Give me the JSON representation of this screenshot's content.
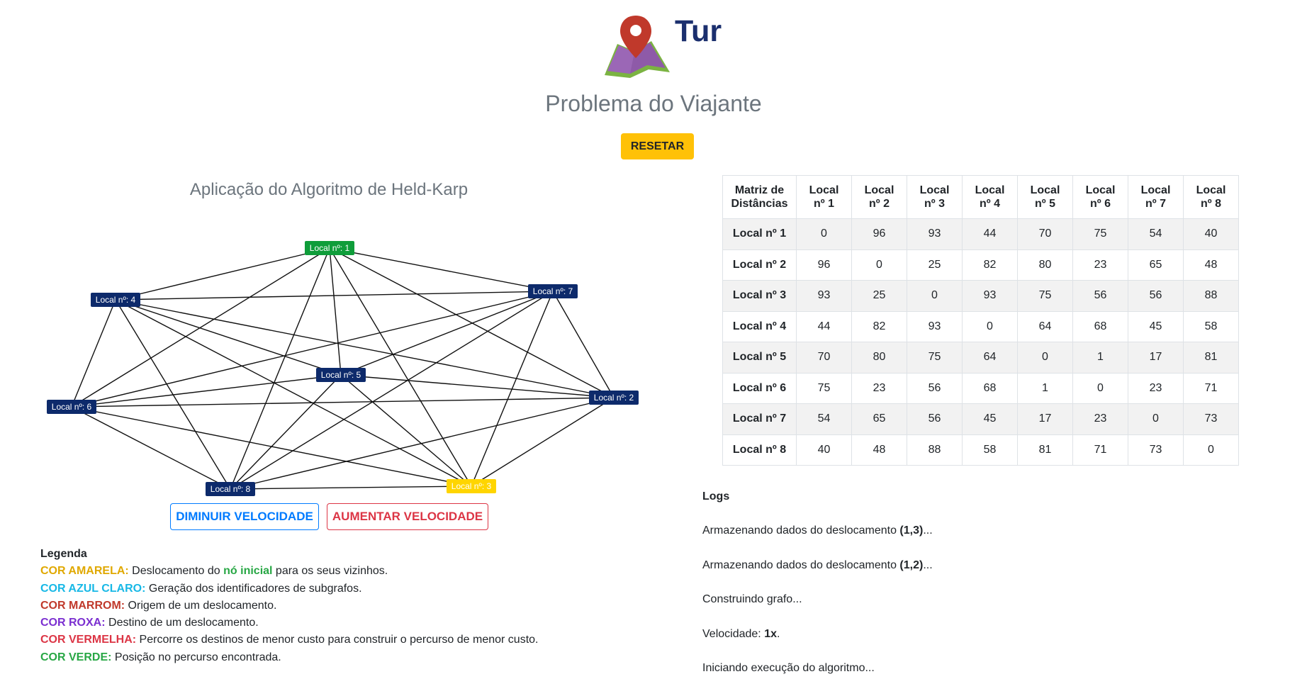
{
  "header": {
    "brand": "Tur",
    "subtitle": "Problema do Viajante",
    "reset_label": "RESETAR",
    "logo_icon": "map-pin-icon"
  },
  "graph": {
    "title": "Aplicação do Algoritmo de Held-Karp",
    "nodes": [
      {
        "id": 1,
        "label": "Local nº: 1",
        "color": "#0f9d3a",
        "text_color": "#ffffff"
      },
      {
        "id": 2,
        "label": "Local nº: 2",
        "color": "#0d2a6b",
        "text_color": "#ffffff"
      },
      {
        "id": 3,
        "label": "Local nº: 3",
        "color": "#ffd500",
        "text_color": "#ffffff"
      },
      {
        "id": 4,
        "label": "Local nº: 4",
        "color": "#0d2a6b",
        "text_color": "#ffffff"
      },
      {
        "id": 5,
        "label": "Local nº: 5",
        "color": "#0d2a6b",
        "text_color": "#ffffff"
      },
      {
        "id": 6,
        "label": "Local nº: 6",
        "color": "#0d2a6b",
        "text_color": "#ffffff"
      },
      {
        "id": 7,
        "label": "Local nº: 7",
        "color": "#0d2a6b",
        "text_color": "#ffffff"
      },
      {
        "id": 8,
        "label": "Local nº: 8",
        "color": "#0d2a6b",
        "text_color": "#ffffff"
      }
    ]
  },
  "controls": {
    "slower_label": "DIMINUIR VELOCIDADE",
    "faster_label": "AUMENTAR VELOCIDADE"
  },
  "legend": {
    "title": "Legenda",
    "items": [
      {
        "key": "COR AMARELA:",
        "key_color": "#e0a800",
        "pre": " Deslocamento do ",
        "highlight": "nó inicial",
        "highlight_color": "#28a745",
        "post": " para os seus vizinhos."
      },
      {
        "key": "COR AZUL CLARO:",
        "key_color": "#17b8e6",
        "text": " Geração dos identificadores de subgrafos."
      },
      {
        "key": "COR MARROM:",
        "key_color": "#c0392b",
        "text": " Origem de um deslocamento."
      },
      {
        "key": "COR ROXA:",
        "key_color": "#7b2fd0",
        "text": " Destino de um deslocamento."
      },
      {
        "key": "COR VERMELHA:",
        "key_color": "#dc3545",
        "text": " Percorre os destinos de menor custo para construir o percurso de menor custo."
      },
      {
        "key": "COR VERDE:",
        "key_color": "#28a745",
        "text": " Posição no percurso encontrada."
      }
    ]
  },
  "matrix": {
    "corner_line1": "Matriz de",
    "corner_line2": "Distâncias",
    "columns": [
      {
        "l1": "Local",
        "l2": "nº 1"
      },
      {
        "l1": "Local",
        "l2": "nº 2"
      },
      {
        "l1": "Local",
        "l2": "nº 3"
      },
      {
        "l1": "Local",
        "l2": "nº 4"
      },
      {
        "l1": "Local",
        "l2": "nº 5"
      },
      {
        "l1": "Local",
        "l2": "nº 6"
      },
      {
        "l1": "Local",
        "l2": "nº 7"
      },
      {
        "l1": "Local",
        "l2": "nº 8"
      }
    ],
    "rows": [
      {
        "label": "Local nº 1",
        "values": [
          0,
          96,
          93,
          44,
          70,
          75,
          54,
          40
        ]
      },
      {
        "label": "Local nº 2",
        "values": [
          96,
          0,
          25,
          82,
          80,
          23,
          65,
          48
        ]
      },
      {
        "label": "Local nº 3",
        "values": [
          93,
          25,
          0,
          93,
          75,
          56,
          56,
          88
        ]
      },
      {
        "label": "Local nº 4",
        "values": [
          44,
          82,
          93,
          0,
          64,
          68,
          45,
          58
        ]
      },
      {
        "label": "Local nº 5",
        "values": [
          70,
          80,
          75,
          64,
          0,
          1,
          17,
          81
        ]
      },
      {
        "label": "Local nº 6",
        "values": [
          75,
          23,
          56,
          68,
          1,
          0,
          23,
          71
        ]
      },
      {
        "label": "Local nº 7",
        "values": [
          54,
          65,
          56,
          45,
          17,
          23,
          0,
          73
        ]
      },
      {
        "label": "Local nº 8",
        "values": [
          40,
          48,
          88,
          58,
          81,
          71,
          73,
          0
        ]
      }
    ]
  },
  "logs": {
    "title": "Logs",
    "lines": [
      {
        "pre": "Armazenando dados do deslocamento ",
        "bold": "(1,3)",
        "post": "..."
      },
      {
        "pre": "Armazenando dados do deslocamento ",
        "bold": "(1,2)",
        "post": "..."
      },
      {
        "pre": "Construindo grafo...",
        "bold": "",
        "post": ""
      },
      {
        "pre": "Velocidade: ",
        "bold": "1x",
        "post": "."
      },
      {
        "pre": "Iniciando execução do algoritmo...",
        "bold": "",
        "post": ""
      }
    ]
  }
}
